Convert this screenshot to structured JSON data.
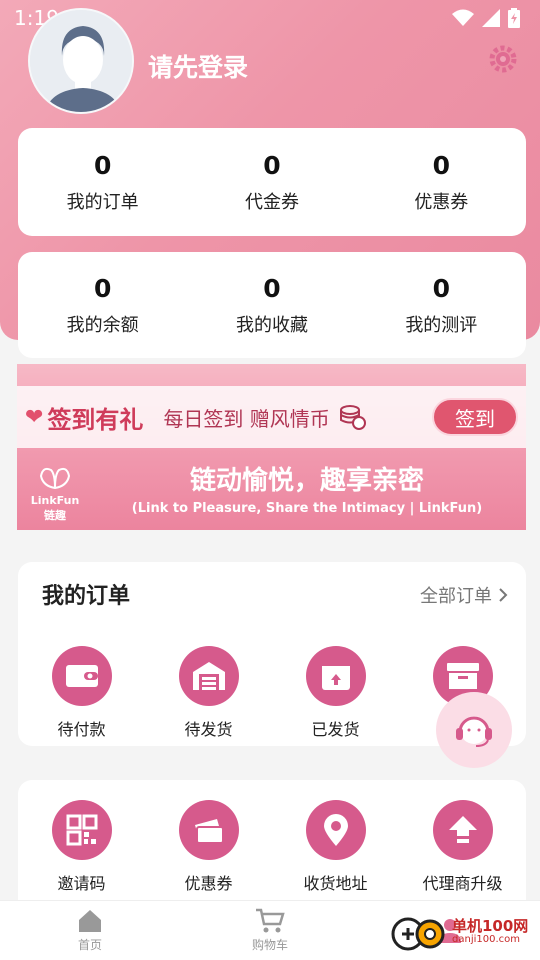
{
  "status_bar": {
    "time": "1:19"
  },
  "profile": {
    "login_prompt": "请先登录"
  },
  "stats_top": [
    {
      "value": "0",
      "label": "我的订单"
    },
    {
      "value": "0",
      "label": "代金券"
    },
    {
      "value": "0",
      "label": "优惠券"
    }
  ],
  "stats_bottom": [
    {
      "value": "0",
      "label": "我的余额"
    },
    {
      "value": "0",
      "label": "我的收藏"
    },
    {
      "value": "0",
      "label": "我的测评"
    }
  ],
  "banner": {
    "sign_title": "签到有礼",
    "sign_sub": "每日签到 赠风情币",
    "sign_button": "签到",
    "logo_text": "LinkFun",
    "logo_cn": "链趣",
    "slogan_cn": "链动愉悦，趣享亲密",
    "slogan_en": "(Link to Pleasure, Share the Intimacy | LinkFun)"
  },
  "orders": {
    "title": "我的订单",
    "all_link": "全部订单",
    "items": [
      {
        "label": "待付款",
        "icon": "wallet-icon"
      },
      {
        "label": "待发货",
        "icon": "warehouse-icon"
      },
      {
        "label": "已发货",
        "icon": "shipped-box-icon"
      },
      {
        "label": "",
        "icon": "archive-icon"
      }
    ]
  },
  "services": {
    "items": [
      {
        "label": "邀请码",
        "icon": "qr-code-icon"
      },
      {
        "label": "优惠券",
        "icon": "coupon-icon"
      },
      {
        "label": "收货地址",
        "icon": "location-pin-icon"
      },
      {
        "label": "代理商升级",
        "icon": "upgrade-arrow-icon"
      }
    ]
  },
  "bottom_nav": [
    {
      "label": "首页",
      "icon": "home-icon"
    },
    {
      "label": "购物车",
      "icon": "cart-icon"
    },
    {
      "label": "",
      "icon": "mine-icon"
    }
  ],
  "watermark": {
    "text": "单机100网",
    "sub": "danji100.com"
  },
  "colors": {
    "accent": "#d65a8c",
    "hero": "#ee95a8",
    "sign_button": "#e0566f"
  }
}
